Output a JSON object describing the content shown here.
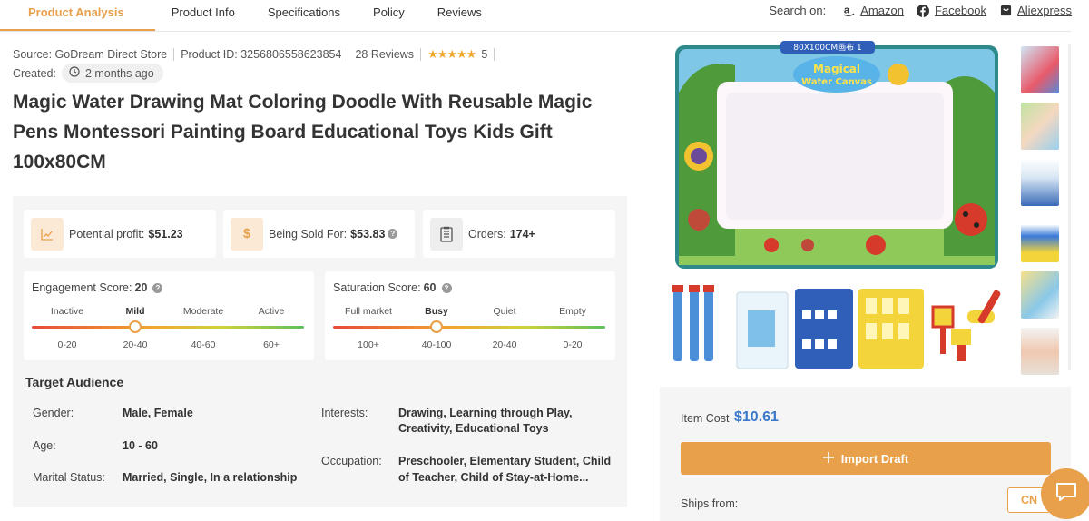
{
  "tabs": [
    "Product Analysis",
    "Product Info",
    "Specifications",
    "Policy",
    "Reviews"
  ],
  "search_on": {
    "label": "Search on:",
    "links": [
      "Amazon",
      "Facebook",
      "Aliexpress"
    ]
  },
  "meta": {
    "source": "Source: GoDream Direct Store",
    "product_id": "Product ID: 3256806558623854",
    "reviews": "28 Reviews",
    "stars": "★★★★★",
    "rating": "5",
    "created_label": "Created:",
    "created_value": "2 months ago"
  },
  "title": "Magic Water Drawing Mat Coloring Doodle With Reusable Magic Pens Montessori Painting Board Educational Toys Kids Gift 100x80CM",
  "stats": {
    "profit_label": "Potential profit:",
    "profit_value": "$51.23",
    "sold_label": "Being Sold For:",
    "sold_value": "$53.83",
    "orders_label": "Orders:",
    "orders_value": "174+",
    "dollar_glyph": "$"
  },
  "engagement": {
    "label": "Engagement Score:",
    "value": "20",
    "levels": [
      "Inactive",
      "Mild",
      "Moderate",
      "Active"
    ],
    "ranges": [
      "0-20",
      "20-40",
      "40-60",
      "60+"
    ],
    "selected_index": 1
  },
  "saturation": {
    "label": "Saturation Score:",
    "value": "60",
    "levels": [
      "Full market",
      "Busy",
      "Quiet",
      "Empty"
    ],
    "ranges": [
      "100+",
      "40-100",
      "20-40",
      "0-20"
    ],
    "selected_index": 1
  },
  "audience": {
    "title": "Target Audience",
    "gender_label": "Gender:",
    "gender_value": "Male, Female",
    "age_label": "Age:",
    "age_value": "10 - 60",
    "marital_label": "Marital Status:",
    "marital_value": "Married, Single, In a relationship",
    "interests_label": "Interests:",
    "interests_line1": "Drawing, Learning through Play,",
    "interests_line2": "Creativity, Educational Toys",
    "occupation_label": "Occupation:",
    "occupation_line1": "Preschooler, Elementary Student, Child",
    "occupation_line2": "of Teacher, Child of Stay-at-Home..."
  },
  "image": {
    "size_banner": "80X100CM画布 1",
    "logo_line1": "Magical",
    "logo_line2": "Water Canvas"
  },
  "cost": {
    "item_cost_label": "Item Cost",
    "item_cost_value": "$10.61",
    "import_label": "Import Draft",
    "ships_from_label": "Ships from:",
    "ships_from_value": "CN"
  },
  "colors": {
    "accent": "#e8a04a",
    "price_blue": "#3a78c9"
  }
}
